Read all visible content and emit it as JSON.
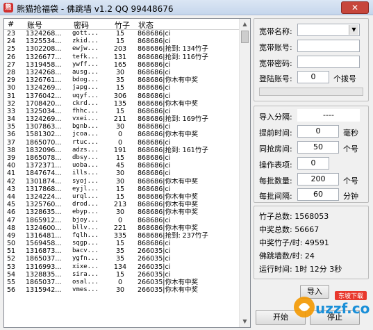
{
  "window": {
    "title": "熊猫抢福袋 - 佛跳墙 v1.2  QQ 99448676",
    "close_label": "✕"
  },
  "grid": {
    "columns": [
      "#",
      "账号",
      "密码",
      "竹子",
      "状态"
    ],
    "rows": [
      [
        "23",
        "1324268...",
        "gott...",
        "15",
        "868686|ci"
      ],
      [
        "24",
        "1325534...",
        "zkid...",
        "15",
        "868686|ci"
      ],
      [
        "25",
        "1302208...",
        "ewjw...",
        "203",
        "868686|抢到: 134竹子"
      ],
      [
        "26",
        "1326677...",
        "tefk...",
        "131",
        "868686|抢到: 116竹子"
      ],
      [
        "27",
        "1319458...",
        "ywff...",
        "165",
        "868686|ci"
      ],
      [
        "28",
        "1324268...",
        "ausg...",
        "30",
        "868686|ci"
      ],
      [
        "29",
        "1326761...",
        "bdog...",
        "35",
        "868686|你木有中奖"
      ],
      [
        "30",
        "1324269...",
        "japg...",
        "15",
        "868686|ci"
      ],
      [
        "31",
        "1376042...",
        "uqyf...",
        "306",
        "868686|ci"
      ],
      [
        "32",
        "1708420...",
        "ckrd...",
        "135",
        "868686|你木有中奖"
      ],
      [
        "33",
        "1325034...",
        "fhhc...",
        "15",
        "868686|ci"
      ],
      [
        "34",
        "1324269...",
        "vxei...",
        "211",
        "868686|抢到: 169竹子"
      ],
      [
        "35",
        "1307863...",
        "bgnb...",
        "30",
        "868686|ci"
      ],
      [
        "36",
        "1581302...",
        "jcoa...",
        "0",
        "868686|你木有中奖"
      ],
      [
        "37",
        "1865070...",
        "rtuc...",
        "0",
        "868686|ci"
      ],
      [
        "38",
        "1832096...",
        "adzs...",
        "191",
        "868686|抢到: 161竹子"
      ],
      [
        "39",
        "1865078...",
        "dbsy...",
        "15",
        "868686|ci"
      ],
      [
        "40",
        "1372371...",
        "uoba...",
        "45",
        "868686|ci"
      ],
      [
        "41",
        "1847674...",
        "ills...",
        "30",
        "868686|ci"
      ],
      [
        "42",
        "1301874...",
        "syoj...",
        "30",
        "868686|你木有中奖"
      ],
      [
        "43",
        "1317868...",
        "eyjl...",
        "15",
        "868686|ci"
      ],
      [
        "44",
        "1324224...",
        "urql...",
        "15",
        "868686|你木有中奖"
      ],
      [
        "45",
        "1325760...",
        "drod...",
        "213",
        "868686|你木有中奖"
      ],
      [
        "46",
        "1328635...",
        "ebyp...",
        "30",
        "868686|你木有中奖"
      ],
      [
        "47",
        "1865912...",
        "bjoy...",
        "0",
        "868686|ci"
      ],
      [
        "48",
        "1324600...",
        "bllv...",
        "221",
        "868686|你木有中奖"
      ],
      [
        "49",
        "1316481...",
        "fqlh...",
        "335",
        "868686|抢到: 237竹子"
      ],
      [
        "50",
        "1569458...",
        "sqgp...",
        "15",
        "868686|ci"
      ],
      [
        "51",
        "1316873...",
        "bacv...",
        "35",
        "266035|ci"
      ],
      [
        "52",
        "1865037...",
        "ygfn...",
        "35",
        "266035|ci"
      ],
      [
        "53",
        "1316993...",
        "xixe...",
        "134",
        "266035|ci"
      ],
      [
        "54",
        "1328835...",
        "sira...",
        "15",
        "266035|ci"
      ],
      [
        "55",
        "1865037...",
        "osal...",
        "0",
        "266035|你木有中奖"
      ],
      [
        "56",
        "1315942...",
        "vmes...",
        "30",
        "266035|你木有中奖"
      ]
    ]
  },
  "account_panel": {
    "broadband_name_label": "宽带名称:",
    "broadband_name_value": "",
    "broadband_account_label": "宽带账号:",
    "broadband_account_value": "",
    "broadband_password_label": "宽带密码:",
    "broadband_password_value": "",
    "login_count_label": "登陆账号:",
    "login_count_value": "0",
    "login_count_suffix": "个拨号"
  },
  "settings_panel": {
    "import_sep_label": "导入分隔:",
    "import_sep_value": "----",
    "advance_label": "提前时间:",
    "advance_value": "0",
    "advance_unit": "毫秒",
    "same_room_label": "同抢房间:",
    "same_room_value": "50",
    "same_room_unit": "个号",
    "op_label": "操作表项:",
    "op_value": "0",
    "batch_count_label": "每批数量:",
    "batch_count_value": "200",
    "batch_count_unit": "个号",
    "batch_interval_label": "每批间隔:",
    "batch_interval_value": "60",
    "batch_interval_unit": "分钟"
  },
  "stats_panel": {
    "total_bamboo": "竹子总数:  1568053",
    "total_wins": "中奖总数:  56667",
    "bamboo_per_hour": "中奖竹子/时:  49591",
    "wall_per_hour": "佛跳墙数/时:  24",
    "runtime": "运行时间:  1时 12分 3秒"
  },
  "buttons": {
    "start": "开始",
    "stop": "停止",
    "partial": "导入"
  },
  "watermark": {
    "text": "uzzf.com",
    "badge": "东坡下载"
  }
}
